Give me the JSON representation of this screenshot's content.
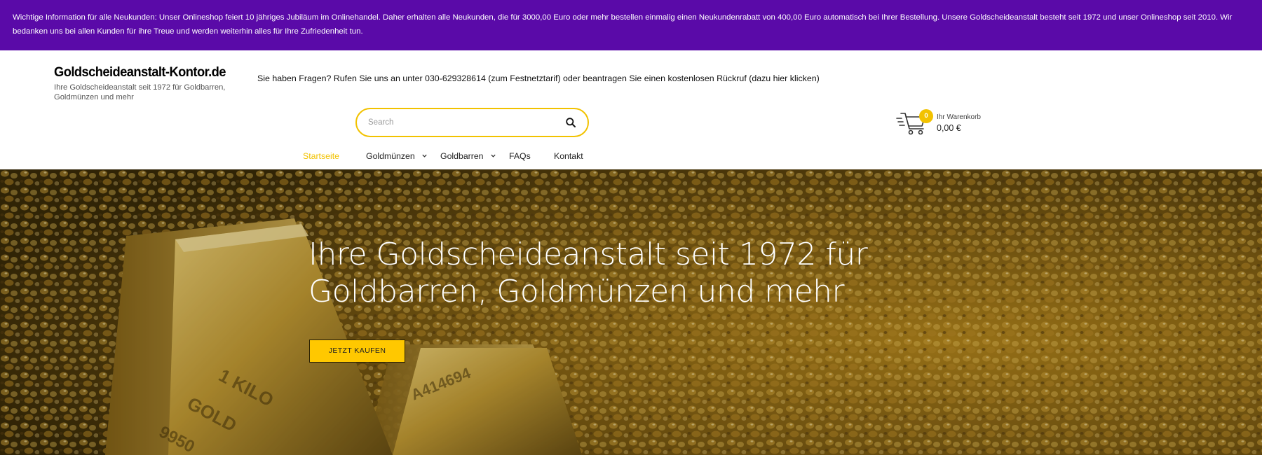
{
  "notice": {
    "text": "Wichtige Information für alle Neukunden: Unser Onlineshop feiert 10 jähriges Jubiläum im Onlinehandel. Daher erhalten alle Neukunden, die für 3000,00 Euro oder mehr bestellen einmalig einen Neukundenrabatt von 400,00 Euro automatisch bei Ihrer Bestellung. Unsere Goldscheideanstalt besteht seit 1972 und unser Onlineshop seit 2010. Wir bedanken uns bei allen Kunden für ihre Treue und werden weiterhin alles für Ihre Zufriedenheit tun.",
    "background_color": "#5a0aa8"
  },
  "logo": {
    "title": "Goldscheideanstalt-Kontor.de",
    "tagline": "Ihre Goldscheideanstalt seit 1972 für Goldbarren, Goldmünzen und mehr"
  },
  "contact": {
    "text": "Sie haben Fragen? Rufen Sie uns an unter 030-629328614 (zum Festnetztarif) oder beantragen Sie einen kostenlosen Rückruf (dazu hier klicken)"
  },
  "search": {
    "placeholder": "Search",
    "value": "",
    "icon": "search-icon",
    "border_color": "#f2c200"
  },
  "cart": {
    "icon": "shopping-cart-icon",
    "count": "0",
    "label": "Ihr Warenkorb",
    "total": "0,00 €"
  },
  "nav": {
    "items": [
      {
        "label": "Startseite",
        "active": true,
        "has_dropdown": false
      },
      {
        "label": "Goldmünzen",
        "active": false,
        "has_dropdown": true
      },
      {
        "label": "Goldbarren",
        "active": false,
        "has_dropdown": true
      },
      {
        "label": "FAQs",
        "active": false,
        "has_dropdown": false
      },
      {
        "label": "Kontakt",
        "active": false,
        "has_dropdown": false
      }
    ],
    "active_color": "#f2c200"
  },
  "hero": {
    "headline": "Ihre Goldscheideanstalt seit 1972 für Goldbarren, Goldmünzen und mehr",
    "cta_label": "JETZT KAUFEN",
    "cta_color": "#ffc800",
    "bar_stamp_text": [
      "1 KILO",
      "GOLD",
      "9950",
      "A414694"
    ]
  },
  "colors": {
    "accent": "#f2c200",
    "notice_purple": "#5a0aa8"
  }
}
